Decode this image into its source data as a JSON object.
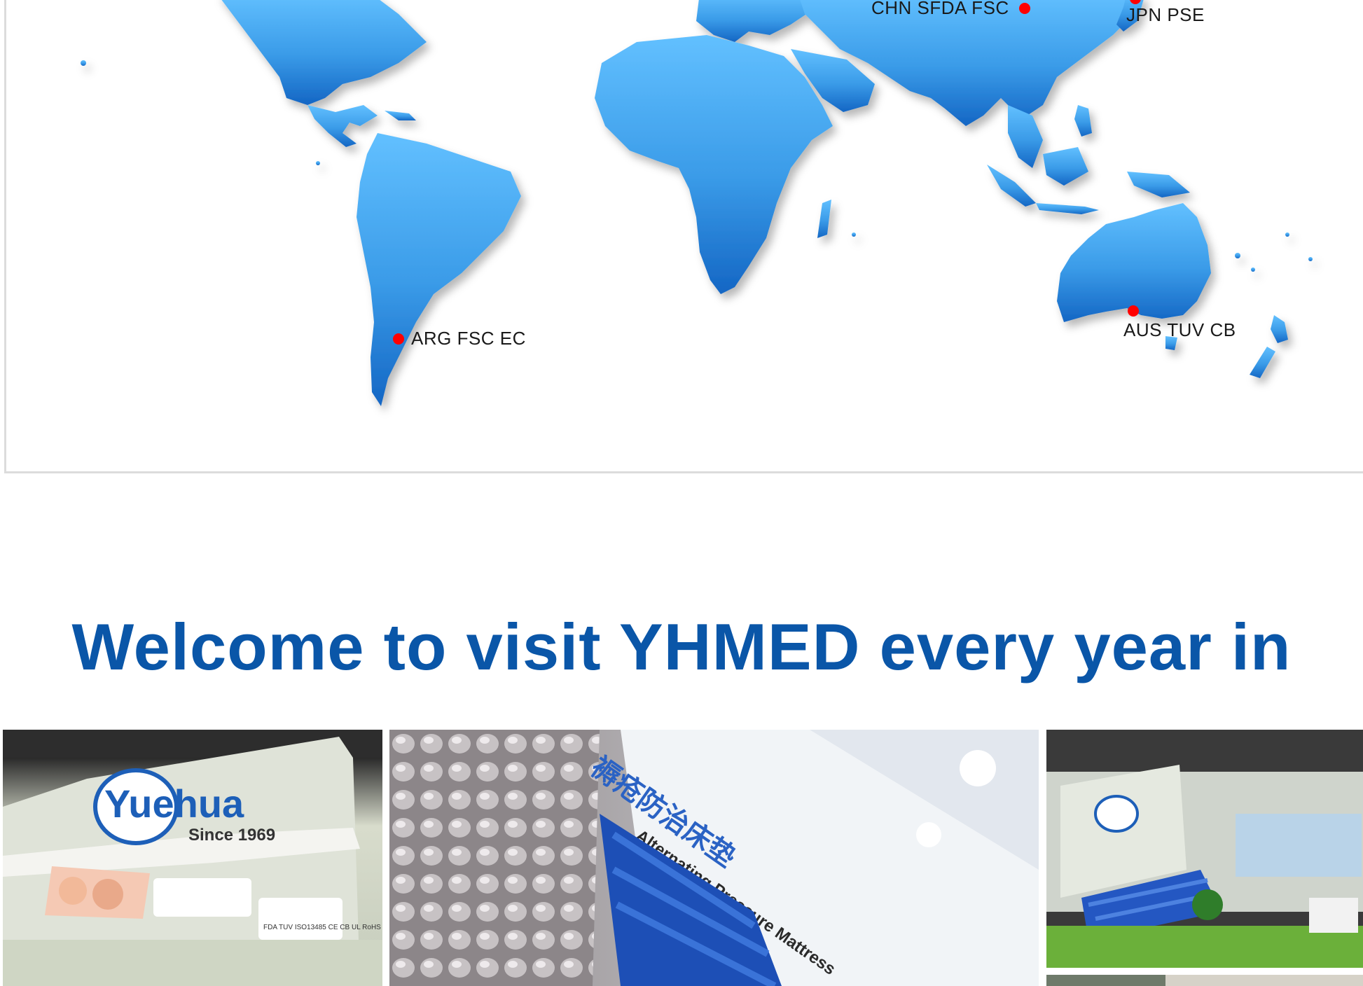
{
  "map": {
    "markers": [
      {
        "id": "chn",
        "label": "CHN SFDA FSC"
      },
      {
        "id": "jpn",
        "label": "JPN PSE"
      },
      {
        "id": "arg",
        "label": "ARG FSC EC"
      },
      {
        "id": "aus",
        "label": "AUS TUV CB"
      }
    ],
    "land_color": "#3a9be8",
    "marker_color": "#ff0000"
  },
  "heading": {
    "text": "Welcome to visit YHMED every year in"
  },
  "gallery": {
    "booth_left": {
      "logo_text": "Yuehua",
      "since_text": "Since 1969",
      "cert_text": "FDA TUV ISO13485 CE CB UL RoHS"
    },
    "booth_center": {
      "sign_cn": "褥疮防治床垫",
      "sign_en": "Alternating Pressure Mattress"
    }
  }
}
